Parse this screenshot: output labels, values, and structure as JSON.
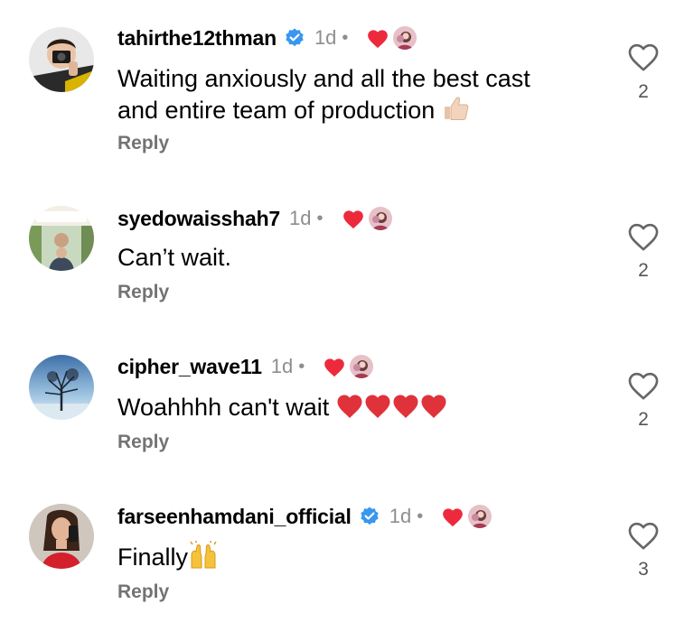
{
  "comments": [
    {
      "username": "tahirthe12thman",
      "verified": true,
      "time": "1d",
      "text_lines": [
        "Waiting anxiously and all the best cast",
        "and entire team of production"
      ],
      "emoji": "thumbs-up",
      "reply_label": "Reply",
      "like_count": "2"
    },
    {
      "username": "syedowaisshah7",
      "verified": false,
      "time": "1d",
      "text": "Can’t wait.",
      "reply_label": "Reply",
      "like_count": "2"
    },
    {
      "username": "cipher_wave11",
      "verified": false,
      "time": "1d",
      "text": "Woahhhh can't wait",
      "emoji": "red-hearts-x4",
      "reply_label": "Reply",
      "like_count": "2"
    },
    {
      "username": "farseenhamdani_official",
      "verified": true,
      "time": "1d",
      "text": "Finally",
      "emoji": "raising-hands",
      "reply_label": "Reply",
      "like_count": "3"
    }
  ],
  "separator": "•",
  "colors": {
    "verified_badge": "#3897f0",
    "liked_heart": "#ed2a3c",
    "muted_text": "#8e8e8e",
    "reply_text": "#737373"
  },
  "icons": {
    "verified": "verified-badge-icon",
    "liked_by_author": "heart-filled-icon",
    "like_button": "heart-outline-icon"
  }
}
